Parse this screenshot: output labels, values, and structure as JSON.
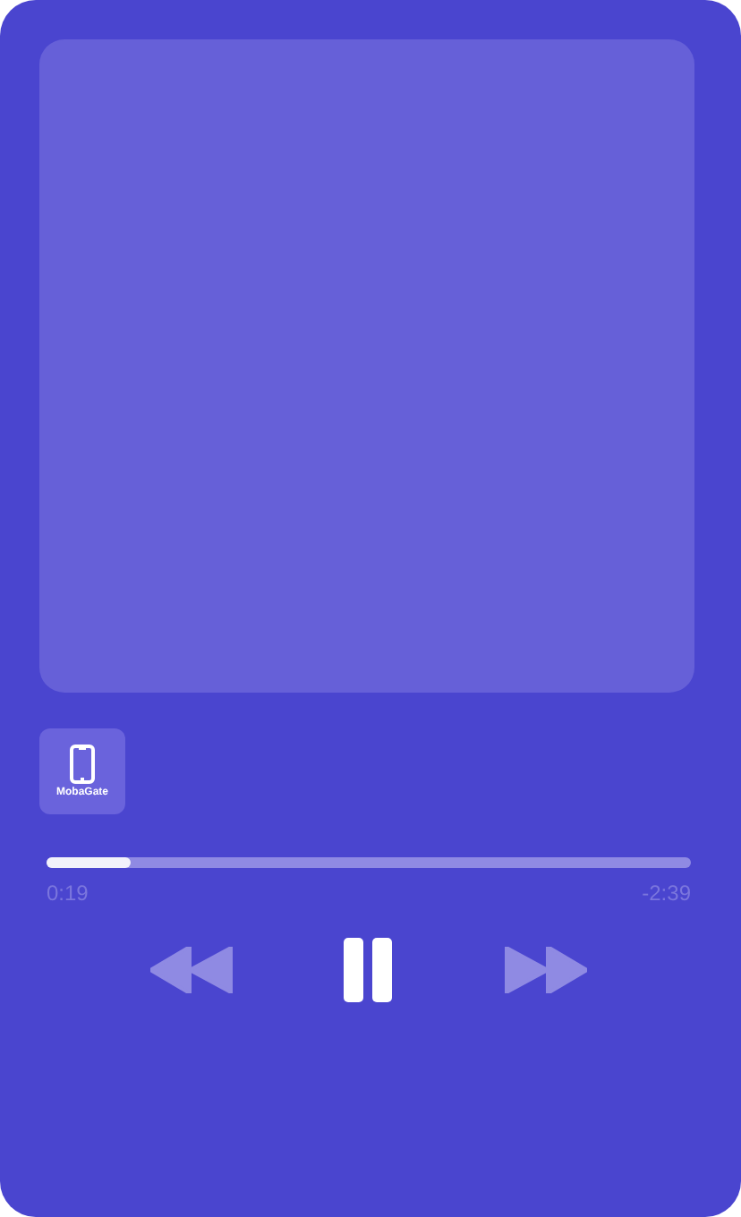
{
  "app_badge": {
    "label": "MobaGate"
  },
  "progress": {
    "level": 0.13,
    "elapsed": "0:19",
    "remaining": "-2:39"
  },
  "controls": {
    "playing": true
  }
}
